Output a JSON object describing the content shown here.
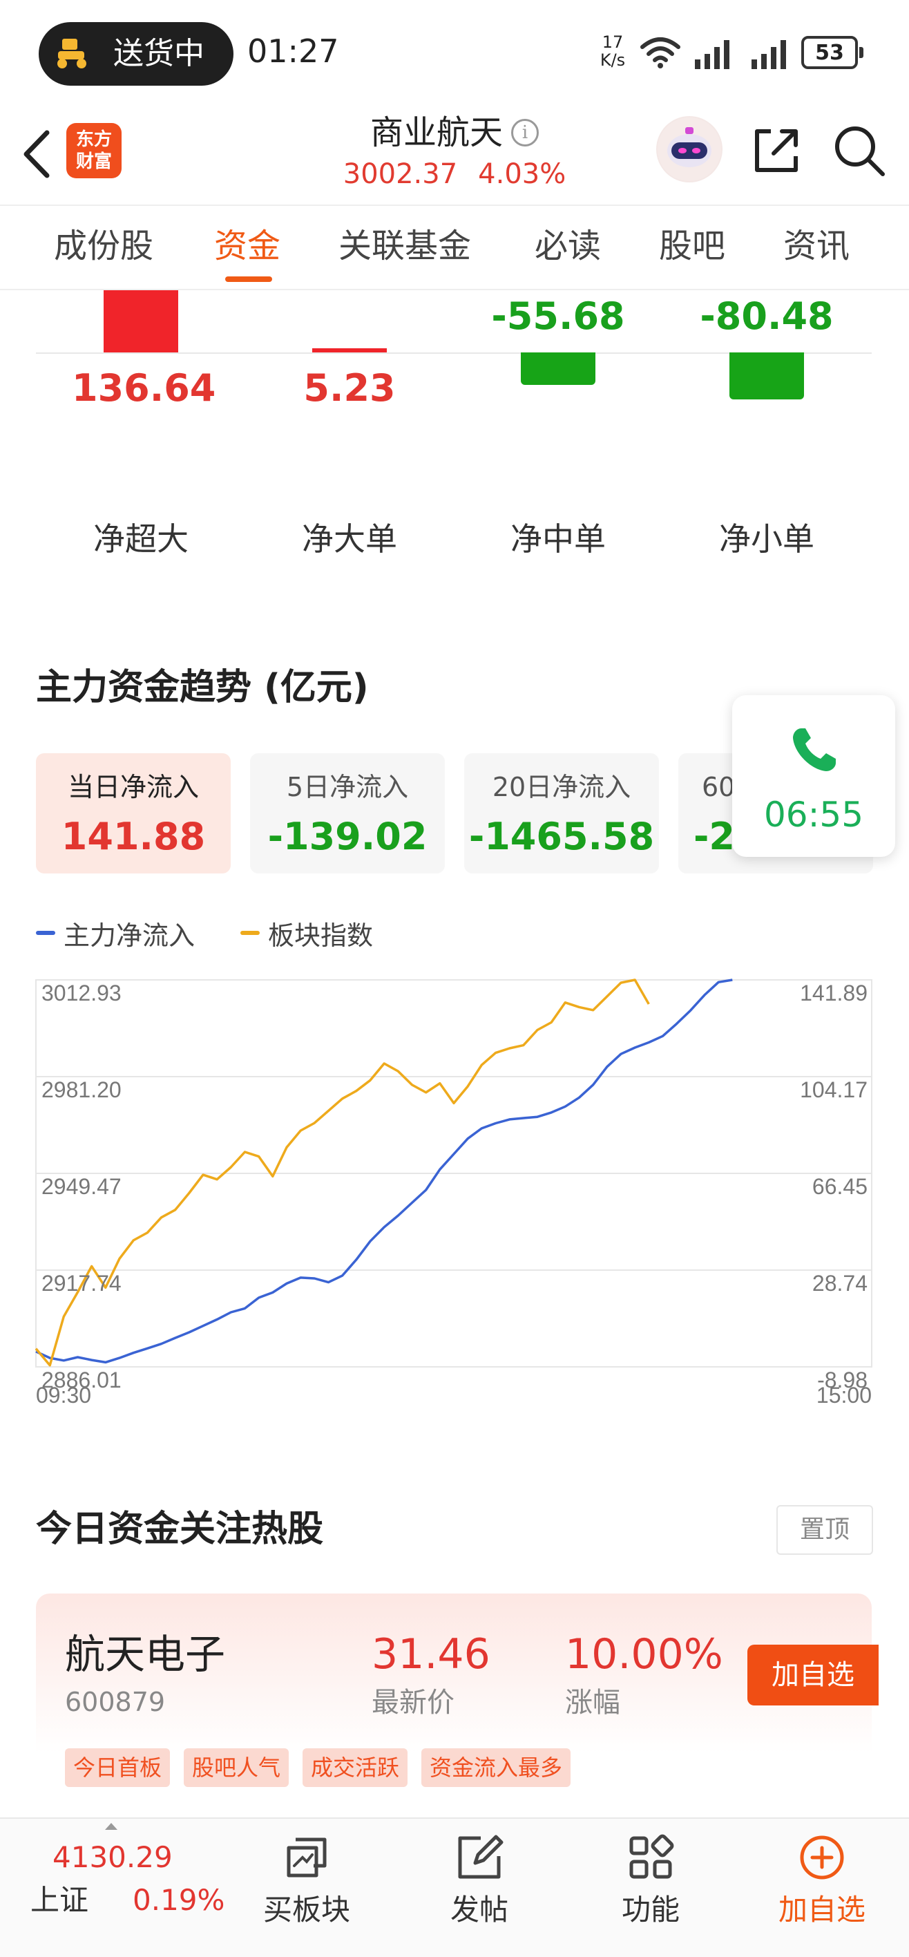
{
  "status_bar": {
    "delivery_label": "送货中",
    "time": "01:27",
    "net_speed_value": "17",
    "net_speed_unit": "K/s",
    "battery": "53"
  },
  "header": {
    "logo_line1": "东方",
    "logo_line2": "财富",
    "title": "商业航天",
    "info_glyph": "i",
    "price": "3002.37",
    "change_pct": "4.03%"
  },
  "tabs": [
    {
      "label": "成份股",
      "active": false
    },
    {
      "label": "资金",
      "active": true
    },
    {
      "label": "关联基金",
      "active": false
    },
    {
      "label": "必读",
      "active": false
    },
    {
      "label": "股吧",
      "active": false
    },
    {
      "label": "资讯",
      "active": false
    }
  ],
  "distribution": {
    "items": [
      {
        "label": "净超大",
        "value": "136.64",
        "amount": 136.64
      },
      {
        "label": "净大单",
        "value": "5.23",
        "amount": 5.23
      },
      {
        "label": "净中单",
        "value": "-55.68",
        "amount": -55.68
      },
      {
        "label": "净小单",
        "value": "-80.48",
        "amount": -80.48
      }
    ]
  },
  "trend": {
    "title": "主力资金趋势 (亿元)",
    "cards": [
      {
        "label": "当日净流入",
        "value": "141.88",
        "active": true,
        "sign": "pos"
      },
      {
        "label": "5日净流入",
        "value": "-139.02",
        "active": false,
        "sign": "neg"
      },
      {
        "label": "20日净流入",
        "value": "-1465.58",
        "active": false,
        "sign": "neg"
      },
      {
        "label": "60",
        "value": "-2",
        "active": false,
        "sign": "neg"
      }
    ],
    "legend": [
      {
        "label": "主力净流入",
        "color": "#3a63d3"
      },
      {
        "label": "板块指数",
        "color": "#eeaa1c"
      }
    ]
  },
  "call_float": {
    "icon": "phone-icon",
    "time": "06:55"
  },
  "chart_data": {
    "type": "line",
    "x_start": "09:30",
    "x_end": "15:00",
    "left_axis_ticks": [
      "3012.93",
      "2981.20",
      "2949.47",
      "2917.74",
      "2886.01"
    ],
    "right_axis_ticks": [
      "141.89",
      "104.17",
      "66.45",
      "28.74",
      "-8.98"
    ],
    "left_ylim": [
      2886.01,
      3012.93
    ],
    "right_ylim": [
      -8.98,
      141.89
    ],
    "grid": true,
    "legend_position": "top-left",
    "series": [
      {
        "name": "主力净流入",
        "axis": "right",
        "color": "#3a63d3",
        "values": [
          -3.0,
          -5.5,
          -6.5,
          -5.2,
          -6.3,
          -7.2,
          -5.5,
          -3.5,
          -1.8,
          0.0,
          2.3,
          4.5,
          7.0,
          9.5,
          12.3,
          13.8,
          18.0,
          20.0,
          23.5,
          25.8,
          25.5,
          24.0,
          26.6,
          32.8,
          40.0,
          45.5,
          50.0,
          55.0,
          60.0,
          68.0,
          74.0,
          80.0,
          84.0,
          86.0,
          87.5,
          88.0,
          88.5,
          90.2,
          92.5,
          96.0,
          101.0,
          108.0,
          113.0,
          115.5,
          117.5,
          120.0,
          124.8,
          130.0,
          136.0,
          141.0,
          141.89
        ]
      },
      {
        "name": "板块指数",
        "axis": "left",
        "color": "#eeaa1c",
        "values": [
          2892.0,
          2886.5,
          2902.5,
          2910.5,
          2919.0,
          2912.0,
          2921.5,
          2927.5,
          2930.0,
          2935.0,
          2937.5,
          2943.0,
          2949.0,
          2947.5,
          2951.5,
          2956.5,
          2955.0,
          2948.5,
          2958.0,
          2963.5,
          2966.0,
          2970.0,
          2974.0,
          2976.5,
          2980.0,
          2985.5,
          2983.0,
          2978.5,
          2976.0,
          2979.0,
          2972.5,
          2978.0,
          2985.0,
          2989.0,
          2990.5,
          2991.5,
          2996.5,
          2999.0,
          3005.5,
          3004.0,
          3003.0,
          3007.5,
          3012.0,
          3012.93,
          3005.0
        ]
      }
    ]
  },
  "hot_stocks": {
    "title": "今日资金关注热股",
    "pin_label": "置顶",
    "items": [
      {
        "name": "航天电子",
        "code": "600879",
        "price": "31.46",
        "price_label": "最新价",
        "change_pct": "10.00%",
        "change_label": "涨幅",
        "add_label": "加自选",
        "tags": [
          "今日首板",
          "股吧人气",
          "成交活跃",
          "资金流入最多"
        ]
      }
    ]
  },
  "bottom_bar": {
    "index_value": "4130.29",
    "index_name": "上证",
    "index_pct": "0.19%",
    "nav": [
      {
        "label": "买板块",
        "icon": "buy-sector-icon"
      },
      {
        "label": "发帖",
        "icon": "compose-icon"
      },
      {
        "label": "功能",
        "icon": "grid-icon"
      },
      {
        "label": "加自选",
        "icon": "add-circle-icon"
      }
    ]
  },
  "colors": {
    "accent": "#f05a15",
    "up": "#e23630",
    "down": "#19a01d",
    "bar_up": "#f0242a",
    "bar_down": "#17a417"
  }
}
